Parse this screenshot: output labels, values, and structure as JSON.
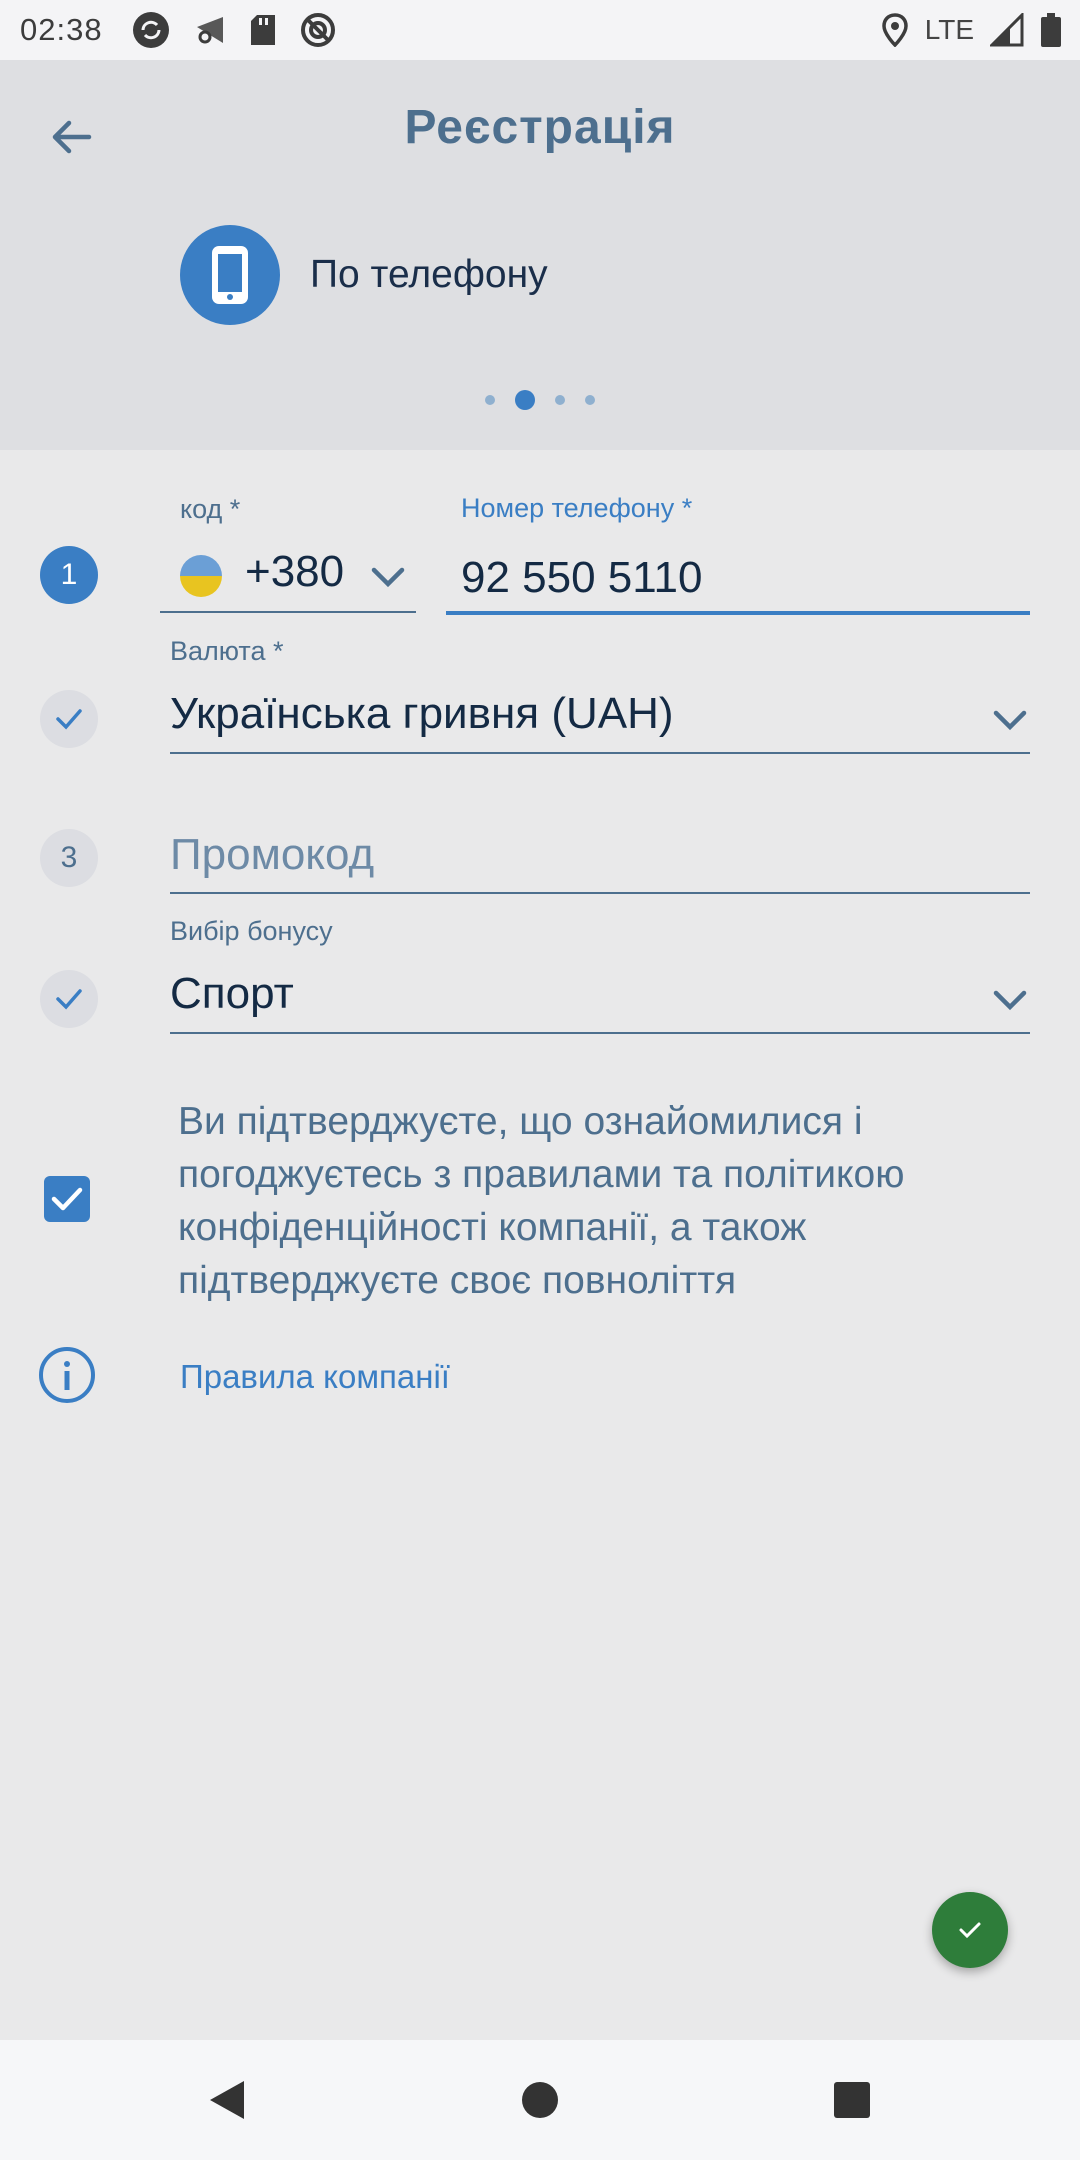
{
  "status_bar": {
    "time": "02:38",
    "network": "LTE",
    "icons": [
      "sync-icon",
      "wifi-settings-icon",
      "sd-card-icon",
      "do-not-disturb-icon",
      "location-icon",
      "signal-icon",
      "battery-icon"
    ]
  },
  "header": {
    "title": "Реєстрація",
    "method_label": "По телефону",
    "method_icon": "phone-icon",
    "pager_total": 4,
    "pager_active": 2
  },
  "form": {
    "step1_number": "1",
    "code_label": "код *",
    "code_value": "+380",
    "phone_label": "Номер телефону *",
    "phone_value": "92 550 5110",
    "currency_label": "Валюта *",
    "currency_value": "Українська гривня (UAH)",
    "step3_number": "3",
    "promo_placeholder": "Промокод",
    "bonus_label": "Вибір бонусу",
    "bonus_value": "Спорт",
    "consent_text": "Ви підтверджуєте, що ознайомилися і погоджуєтесь з правилами та політикою конфіденційності компанії, а також підтверджуєте своє повноліття",
    "consent_checked": true,
    "rules_link": "Правила компанії"
  },
  "colors": {
    "accent": "#3a7ec4",
    "title": "#4d6f8e",
    "fab": "#2e7d3a",
    "background": "#e9e9ea"
  }
}
